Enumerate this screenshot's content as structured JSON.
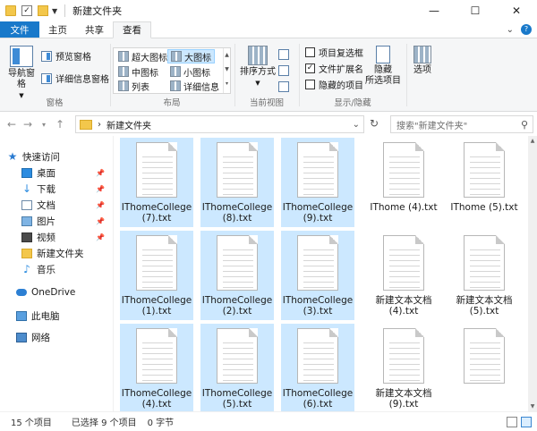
{
  "window": {
    "title": "新建文件夹",
    "controls": {
      "minimize": "—",
      "maximize": "☐",
      "close": "✕"
    }
  },
  "ribbon_tabs": [
    {
      "label": "文件"
    },
    {
      "label": "主页"
    },
    {
      "label": "共享"
    },
    {
      "label": "查看"
    }
  ],
  "ribbon": {
    "pane": {
      "nav_pane": "导航窗格",
      "preview_pane": "预览窗格",
      "details_pane": "详细信息窗格",
      "label": "窗格"
    },
    "layout": {
      "items": [
        "超大图标",
        "大图标",
        "中图标",
        "小图标",
        "列表",
        "详细信息"
      ],
      "selected": "大图标",
      "label": "布局"
    },
    "current_view": {
      "sort": "排序方式",
      "label": "当前视图"
    },
    "show_hide": {
      "item_checkboxes": "项目复选框",
      "file_extensions": "文件扩展名",
      "hidden_items": "隐藏的项目",
      "hide_selected": "隐藏\n所选项目",
      "label": "显示/隐藏"
    },
    "options": {
      "label": "选项"
    }
  },
  "address": {
    "path": "新建文件夹",
    "search_placeholder": "搜索\"新建文件夹\""
  },
  "nav_pane": {
    "quick_access": "快速访问",
    "items": [
      "桌面",
      "下载",
      "文档",
      "图片",
      "视频",
      "新建文件夹",
      "音乐"
    ],
    "onedrive": "OneDrive",
    "this_pc": "此电脑",
    "network": "网络"
  },
  "files": [
    {
      "name": "IThomeCollege (7).txt",
      "selected": true
    },
    {
      "name": "IThomeCollege (8).txt",
      "selected": true
    },
    {
      "name": "IThomeCollege (9).txt",
      "selected": true
    },
    {
      "name": "IThome (4).txt",
      "selected": false
    },
    {
      "name": "IThome (5).txt",
      "selected": false
    },
    {
      "name": "IThomeCollege (1).txt",
      "selected": true
    },
    {
      "name": "IThomeCollege (2).txt",
      "selected": true
    },
    {
      "name": "IThomeCollege (3).txt",
      "selected": true
    },
    {
      "name": "新建文本文档 (4).txt",
      "selected": false
    },
    {
      "name": "新建文本文档 (5).txt",
      "selected": false
    },
    {
      "name": "IThomeCollege (4).txt",
      "selected": true
    },
    {
      "name": "IThomeCollege (5).txt",
      "selected": true
    },
    {
      "name": "IThomeCollege (6).txt",
      "selected": true
    },
    {
      "name": "新建文本文档 (9).txt",
      "selected": false
    },
    {
      "name": "",
      "selected": false
    }
  ],
  "status": {
    "count": "15 个项目",
    "selection": "已选择 9 个项目",
    "size": "0 字节"
  },
  "colors": {
    "file_tab": "#1979ca",
    "selection": "#cce8ff",
    "ribbon_bg": "#f5f6f7"
  }
}
